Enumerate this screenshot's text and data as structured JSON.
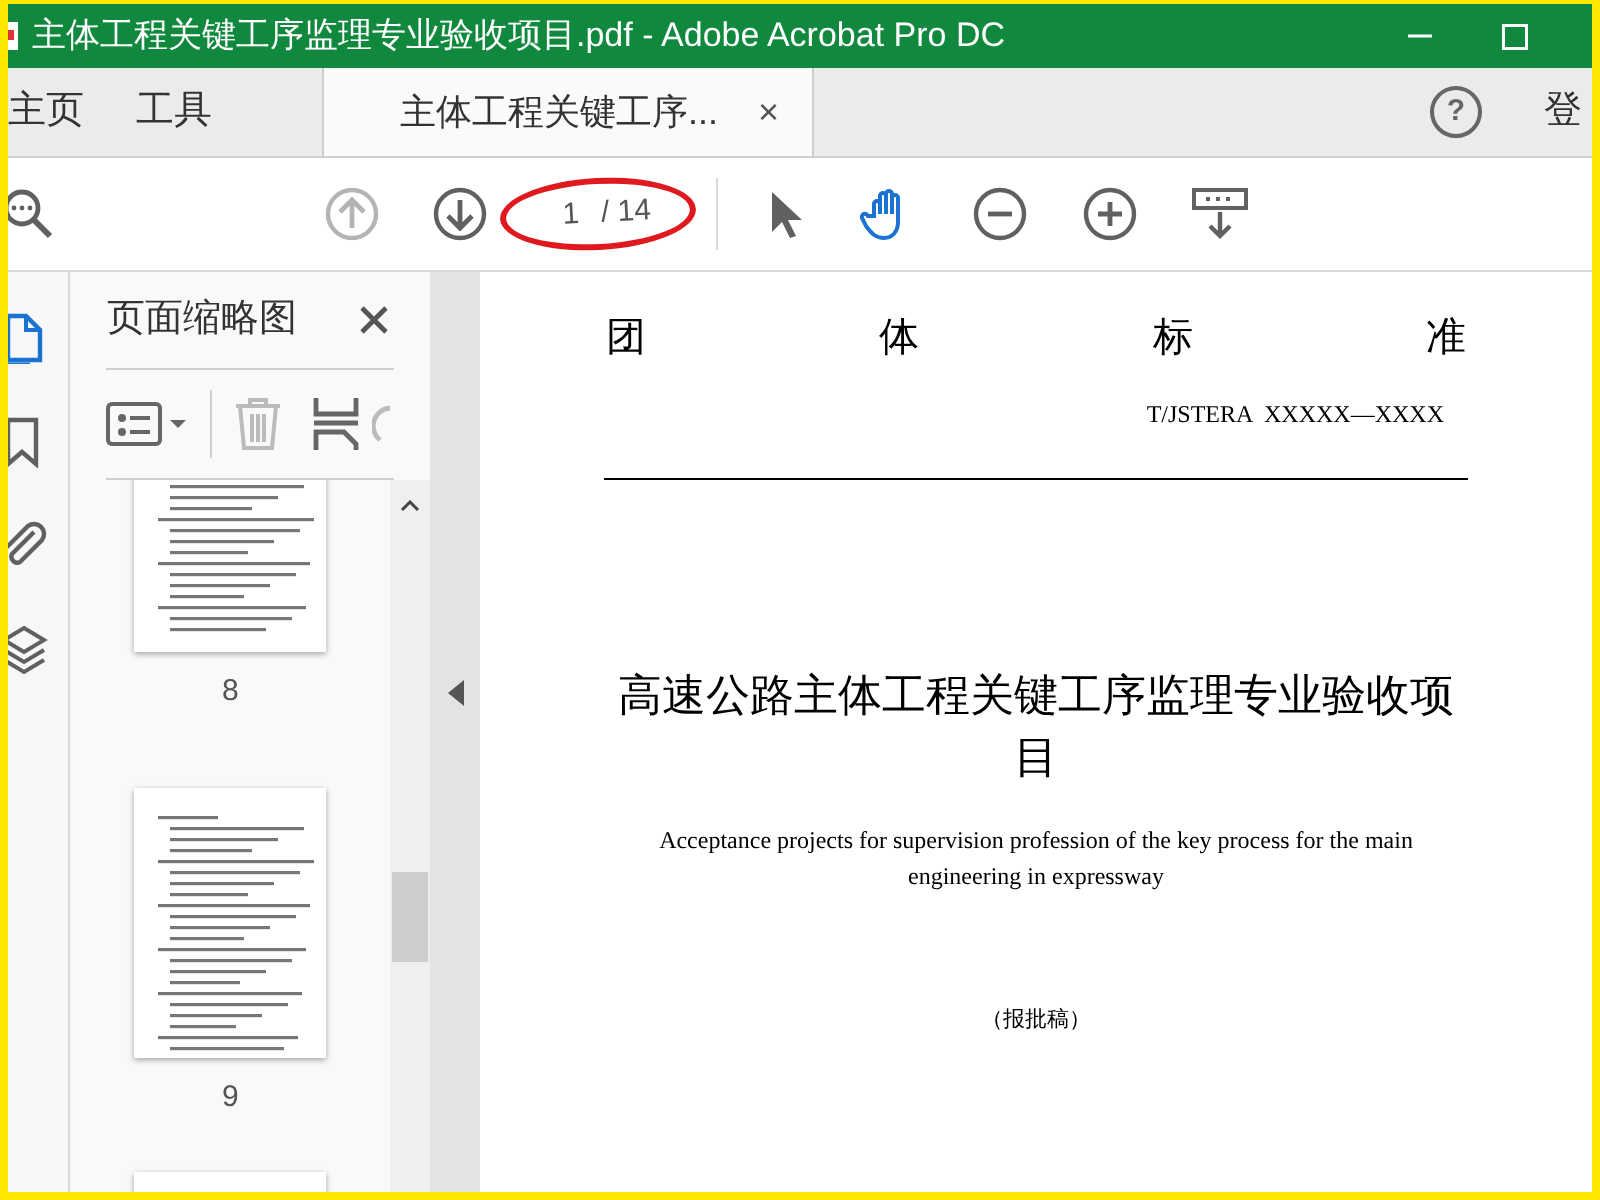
{
  "window": {
    "title": "主体工程关键工序监理专业验收项目.pdf - Adobe Acrobat Pro DC"
  },
  "tabs": [
    {
      "label": "主页",
      "kind": "nav",
      "selected": false
    },
    {
      "label": "工具",
      "kind": "nav",
      "selected": false
    },
    {
      "label": "主体工程关键工序...",
      "kind": "document",
      "selected": true,
      "close": "×"
    }
  ],
  "help": {
    "label": "?"
  },
  "account": {
    "label": "登"
  },
  "toolbar": {
    "tools": [
      {
        "kind": "search",
        "selected": false
      },
      {
        "kind": "prev",
        "disabled": true
      },
      {
        "kind": "next",
        "disabled": false
      },
      {
        "kind": "select",
        "selected": false
      },
      {
        "kind": "hand",
        "selected": true
      },
      {
        "kind": "zoomout",
        "selected": false
      },
      {
        "kind": "zoomin",
        "selected": false
      },
      {
        "kind": "keyboard",
        "selected": false
      }
    ],
    "page_input": "1",
    "page_total": "/ 14"
  },
  "side_rail": [
    {
      "kind": "pages",
      "selected": true
    },
    {
      "kind": "bookmark",
      "selected": false
    },
    {
      "kind": "attach",
      "selected": false
    },
    {
      "kind": "layers",
      "selected": false
    }
  ],
  "panel": {
    "title": "页面缩略图",
    "thumbnails": [
      {
        "label": "8"
      },
      {
        "label": "9"
      }
    ]
  },
  "document": {
    "heading": [
      "团",
      "体",
      "标",
      "准"
    ],
    "code": "T/JSTERA  XXXXX—XXXX",
    "title": "高速公路主体工程关键工序监理专业验收项目",
    "subtitle": "Acceptance projects for supervision profession of the key process for the main engineering in expressway",
    "note": "（报批稿）"
  }
}
